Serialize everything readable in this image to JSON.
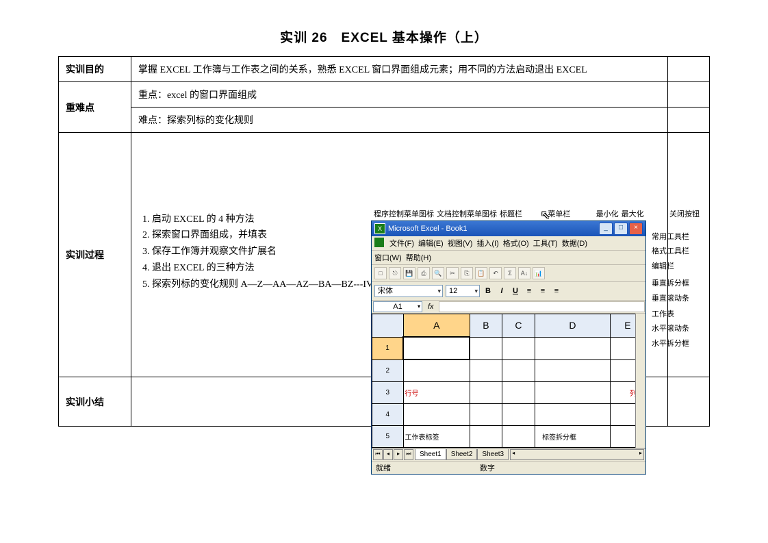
{
  "title": "实训 26　EXCEL 基本操作（上）",
  "rows": {
    "purpose_label": "实训目的",
    "purpose_text": "掌握 EXCEL 工作簿与工作表之间的关系，熟悉 EXCEL 窗口界面组成元素；用不同的方法启动退出 EXCEL",
    "difficulty_label": "重难点",
    "difficulty_key": "重点：excel 的窗口界面组成",
    "difficulty_hard": "难点：探索列标的变化规则",
    "process_label": "实训过程",
    "steps": [
      "启动 EXCEL 的 4 种方法",
      "探索窗口界面组成，并填表",
      "保存工作簿并观察文件扩展名",
      "退出 EXCEL 的三种方法",
      "探索列标的变化规则 A—Z—AA—AZ—BA—BZ---IV"
    ],
    "summary_label": "实训小结"
  },
  "excel": {
    "topcallouts": [
      "程序控制菜单图标",
      "文档控制菜单图标",
      "标题栏",
      "菜单栏",
      "最小化",
      "最大化",
      "关闭按钮"
    ],
    "sidecallouts": [
      "常用工具栏",
      "格式工具栏",
      "编辑栏",
      "垂直拆分框",
      "垂直滚动条",
      "工作表",
      "水平滚动条",
      "水平拆分框"
    ],
    "title": "Microsoft Excel - Book1",
    "menus": [
      "文件(F)",
      "编辑(E)",
      "视图(V)",
      "插入(I)",
      "格式(O)",
      "工具(T)",
      "数据(D)"
    ],
    "menus2": [
      "窗口(W)",
      "帮助(H)"
    ],
    "font": "宋体",
    "size": "12",
    "fmtbtns": [
      "B",
      "I",
      "U"
    ],
    "namebox": "A1",
    "fx": "fx",
    "cols": [
      "A",
      "B",
      "C",
      "D",
      "E"
    ],
    "rows": [
      "1",
      "2",
      "3",
      "4",
      "5"
    ],
    "row_annot": "行号",
    "col_annot": "列号",
    "cell_annot1": "工作表标签",
    "cell_annot2": "标签拆分框",
    "sheets": [
      "Sheet1",
      "Sheet2",
      "Sheet3"
    ],
    "status_left": "就绪",
    "status_right": "数字"
  }
}
